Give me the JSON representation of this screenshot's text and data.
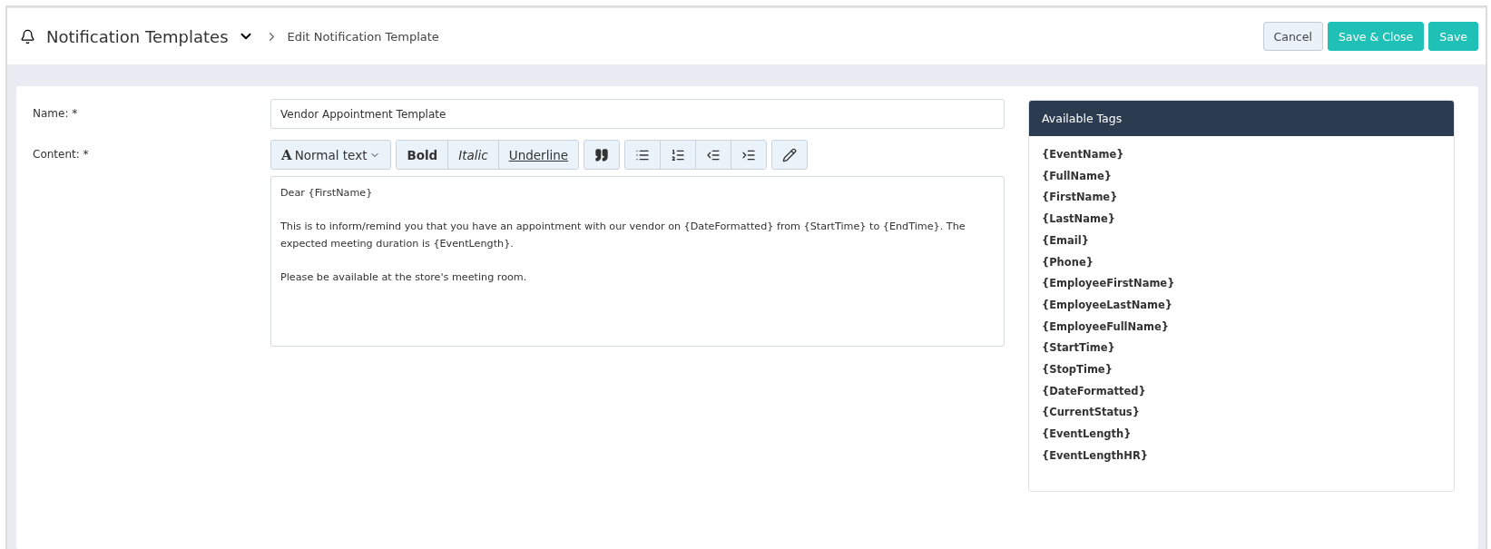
{
  "header": {
    "title": "Notification Templates",
    "breadcrumb": "Edit Notification Template",
    "buttons": [
      {
        "label": "Cancel",
        "kind": "secondary"
      },
      {
        "label": "Save & Close",
        "kind": "primary"
      },
      {
        "label": "Save",
        "kind": "primary"
      }
    ]
  },
  "form": {
    "name_label": "Name: *",
    "name_value": "Vendor Appointment Template",
    "content_label": "Content: *",
    "toolbar": {
      "format_glyph": "A",
      "format": "Normal text",
      "styles": [
        "Bold",
        "Italic",
        "Underline"
      ]
    },
    "content": [
      "Dear {FirstName}",
      "This is to inform/remind you that you have an appointment with our vendor on {DateFormatted} from {StartTime} to {EndTime}. The expected meeting duration is {EventLength}.",
      "Please be available at the store's meeting room."
    ]
  },
  "tags_panel": {
    "title": "Available Tags",
    "tags": [
      "{EventName}",
      "{FullName}",
      "{FirstName}",
      "{LastName}",
      "{Email}",
      "{Phone}",
      "{EmployeeFirstName}",
      "{EmployeeLastName}",
      "{EmployeeFullName}",
      "{StartTime}",
      "{StopTime}",
      "{DateFormatted}",
      "{CurrentStatus}",
      "{EventLength}",
      "{EventLengthHR}"
    ]
  }
}
